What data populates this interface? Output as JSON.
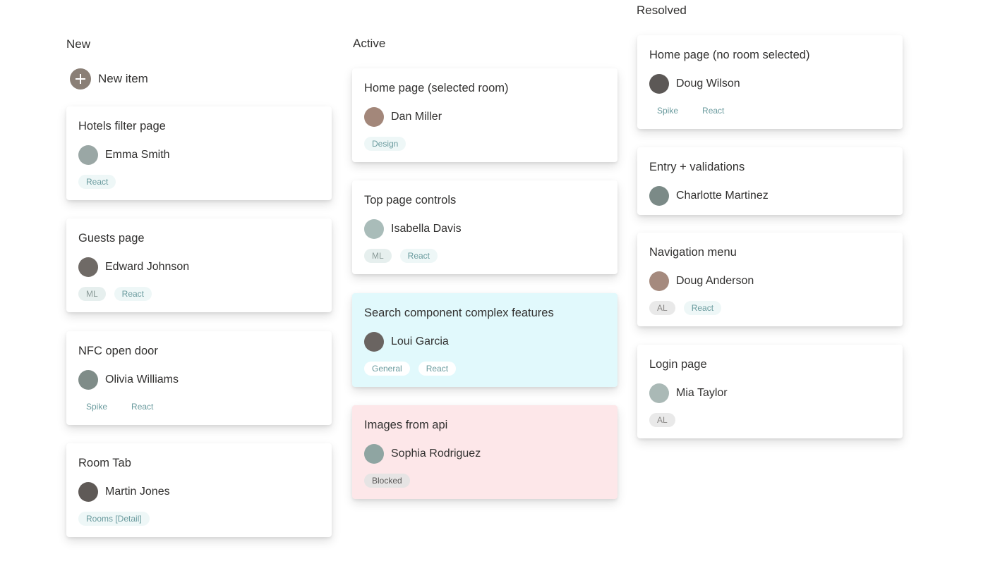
{
  "columns": [
    {
      "title": "New"
    },
    {
      "title": "Active"
    },
    {
      "title": "Resolved"
    }
  ],
  "new_item_label": "New item",
  "cards": {
    "new": [
      {
        "title": "Hotels filter page",
        "person": "Emma Smith",
        "tags": [
          "React"
        ]
      },
      {
        "title": "Guests page",
        "person": "Edward Johnson",
        "tags": [
          "ML",
          "React"
        ]
      },
      {
        "title": "NFC open door",
        "person": "Olivia Williams",
        "tags": [
          "Spike",
          "React"
        ]
      },
      {
        "title": "Room Tab",
        "person": "Martin Jones",
        "tags": [
          "Rooms [Detail]"
        ]
      }
    ],
    "active": [
      {
        "title": "Home page (selected room)",
        "person": "Dan Miller",
        "tags": [
          "Design"
        ]
      },
      {
        "title": "Top page controls",
        "person": "Isabella Davis",
        "tags": [
          "ML",
          "React"
        ]
      },
      {
        "title": "Search component complex features",
        "person": "Loui Garcia",
        "tags": [
          "General",
          "React"
        ],
        "highlight": "blue"
      },
      {
        "title": "Images from api",
        "person": "Sophia Rodriguez",
        "tags": [
          "Blocked"
        ],
        "highlight": "pink"
      }
    ],
    "resolved": [
      {
        "title": "Home page (no room selected)",
        "person": "Doug Wilson",
        "tags": [
          "Spike",
          "React"
        ]
      },
      {
        "title": "Entry + validations",
        "person": "Charlotte Martinez",
        "tags": []
      },
      {
        "title": "Navigation menu",
        "person": "Doug Anderson",
        "tags": [
          "AL",
          "React"
        ]
      },
      {
        "title": "Login page",
        "person": "Mia Taylor",
        "tags": [
          "AL"
        ]
      }
    ]
  },
  "colors": {
    "highlight_blue": "#e1f9fc",
    "highlight_pink": "#fde7e9",
    "tag_text": "#6a9b9e",
    "add_button": "#8a7f76"
  }
}
